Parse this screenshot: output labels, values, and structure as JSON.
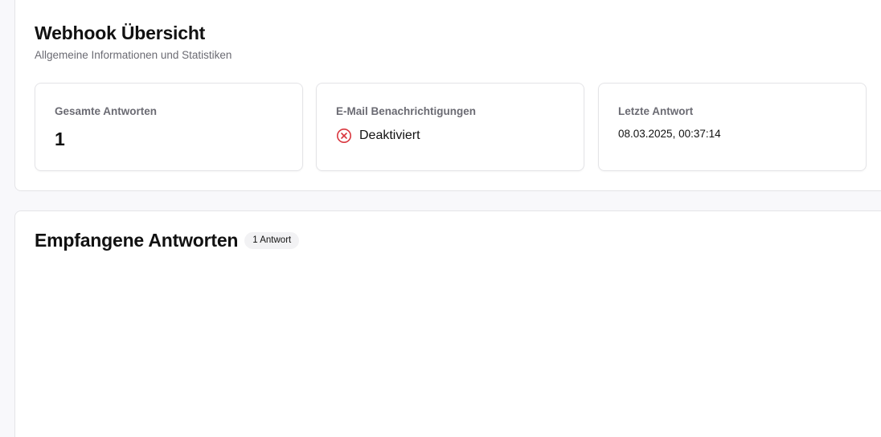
{
  "overview": {
    "title": "Webhook Übersicht",
    "subtitle": "Allgemeine Informationen und Statistiken"
  },
  "stats": {
    "total_responses": {
      "label": "Gesamte Antworten",
      "value": "1"
    },
    "email_notifications": {
      "label": "E-Mail Benachrichtigungen",
      "status": "Deaktiviert",
      "status_icon": "x-circle-icon",
      "status_color": "#d9363e"
    },
    "last_response": {
      "label": "Letzte Antwort",
      "timestamp": "08.03.2025, 00:37:14"
    }
  },
  "responses": {
    "title": "Empfangene Antworten",
    "count_badge": "1 Antwort"
  }
}
